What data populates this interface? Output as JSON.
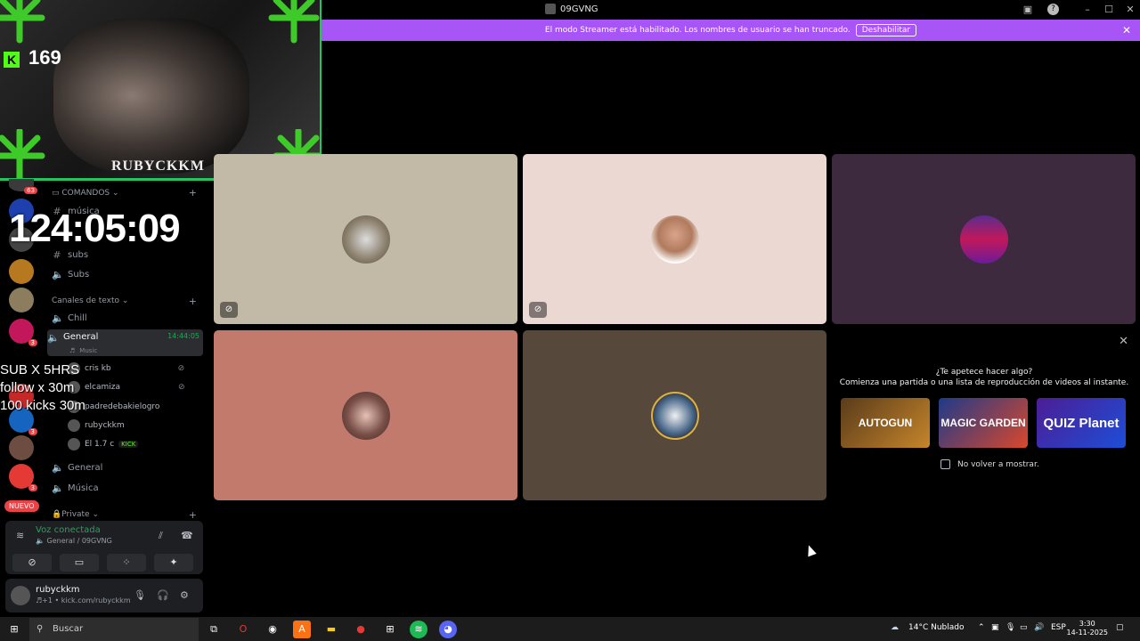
{
  "window": {
    "title": "09GVNG",
    "controls": [
      "minimize-icon",
      "maximize-icon",
      "close-icon"
    ]
  },
  "banner": {
    "message": "El modo Streamer está habilitado. Los nombres de usuario se han truncado.",
    "disable_label": "Deshabilitar"
  },
  "overlay": {
    "viewer_count": "169",
    "kick_letter": "K",
    "cam_tag": "RUBYCKKM",
    "timer": "124:05:09",
    "goals": [
      "SUB X 5HRS",
      "follow x 30m",
      "100 kicks 30m"
    ]
  },
  "guilds": [
    {
      "badge": "63"
    },
    {
      "badge": ""
    },
    {
      "badge": ""
    },
    {
      "label": "Rubyckkm",
      "badge": ""
    },
    {
      "badge": ""
    },
    {
      "badge": "3"
    },
    {
      "badge": ""
    },
    {
      "badge": "3"
    },
    {
      "badge": "3"
    },
    {
      "badge": "3"
    }
  ],
  "new_label": "NUEVO",
  "channels": {
    "cat_commands": "COMANDOS",
    "musica_hash": "música",
    "subs_hash": "subs",
    "subs_voice": "Subs",
    "cat_text": "Canales de texto",
    "chill": "Chill",
    "general_active": "General",
    "general_timer": "14:44:05",
    "general_sub": "Music",
    "members": [
      {
        "name": "cris kb"
      },
      {
        "name": "elcamiza"
      },
      {
        "name": "padredebakielogro"
      },
      {
        "name": "rubyckkm"
      },
      {
        "name": "El 1.7 c",
        "tag": "KICK"
      }
    ],
    "general": "General",
    "musica_voice": "Música",
    "cat_private": "Private"
  },
  "voice": {
    "status": "Voz conectada",
    "location": "General / 09GVNG"
  },
  "user": {
    "name": "rubyckkm",
    "status": "♬+1 • kick.com/rubyckkm"
  },
  "activity": {
    "question": "¿Te apetece hacer algo?",
    "subtitle": "Comienza una partida o una lista de reproducción de videos al instante.",
    "games": [
      "AUTOGUN",
      "MAGIC GARDEN",
      "QUIZ Planet"
    ],
    "dont_show": "No volver a mostrar."
  },
  "taskbar": {
    "search": "Buscar",
    "weather": "14°C  Nublado",
    "lang": "ESP",
    "time": "3:30",
    "date": "14-11-2025"
  },
  "colors": {
    "banner": "#a855f7",
    "kick_green": "#53fc18",
    "tile_1": "#c2b9a7",
    "tile_2": "#ecd8d3",
    "tile_3": "#3e2a3f",
    "tile_4": "#c27a6c",
    "tile_5": "#56493b"
  }
}
